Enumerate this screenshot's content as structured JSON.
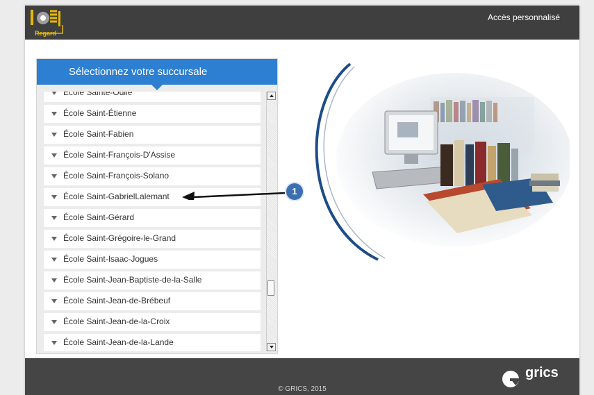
{
  "header": {
    "logo_text": "Regard",
    "access_link": "Accès personnalisé"
  },
  "panel": {
    "title": "Sélectionnez votre succursale",
    "items": [
      "École Sainte-Odile",
      "École Saint-Étienne",
      "École Saint-Fabien",
      "École Saint-François-D'Assise",
      "École Saint-François-Solano",
      "École Saint-GabrielLalemant",
      "École Saint-Gérard",
      "École Saint-Grégoire-le-Grand",
      "École Saint-Isaac-Jogues",
      "École Saint-Jean-Baptiste-de-la-Salle",
      "École Saint-Jean-de-Brébeuf",
      "École Saint-Jean-de-la-Croix",
      "École Saint-Jean-de-la-Lande"
    ]
  },
  "callout": {
    "number": "1"
  },
  "footer": {
    "copyright": "© GRICS, 2015",
    "brand": "grics"
  },
  "colors": {
    "accent": "#2d7fd2",
    "header_bg": "#3f3f3f",
    "footer_bg": "#454545",
    "callout": "#3b6fb0"
  },
  "icons": {
    "list_item": "triangle-down-icon",
    "logo": "regard-logo-icon",
    "brand": "grics-logo-icon"
  }
}
